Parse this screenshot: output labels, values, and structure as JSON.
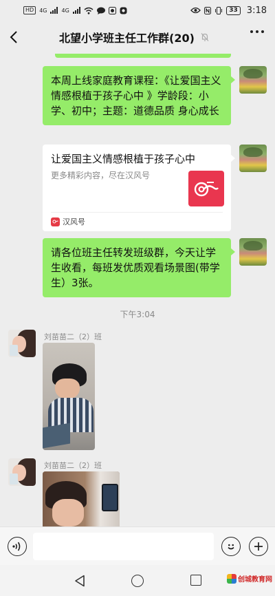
{
  "status_bar": {
    "network_tags": [
      "HD",
      "4G",
      "4G"
    ],
    "battery": "33",
    "time": "3:18"
  },
  "header": {
    "title": "北望小学班主任工作群(20)"
  },
  "messages": [
    {
      "type": "text",
      "from_self": true,
      "text": "本周上线家庭教育课程：《让爱国主义情感根植于孩子心中 》学龄段：小学、初中；主题：道德品质 身心成长"
    },
    {
      "type": "card",
      "from_self": true,
      "title": "让爱国主义情感根植于孩子心中",
      "description": "更多精彩内容，尽在汉风号",
      "source": "汉风号"
    },
    {
      "type": "text",
      "from_self": true,
      "text": "请各位班主任转发班级群，今天让学生收看，每班发优质观看场景图(带学生）3张。"
    },
    {
      "type": "timestamp",
      "text": "下午3:04"
    },
    {
      "type": "image",
      "from_self": false,
      "sender": "刘苗苗二（2）班"
    },
    {
      "type": "image",
      "from_self": false,
      "sender": "刘苗苗二（2）班"
    }
  ],
  "input_bar": {
    "value": "",
    "placeholder": ""
  },
  "watermark": {
    "text": "创城教育网"
  }
}
